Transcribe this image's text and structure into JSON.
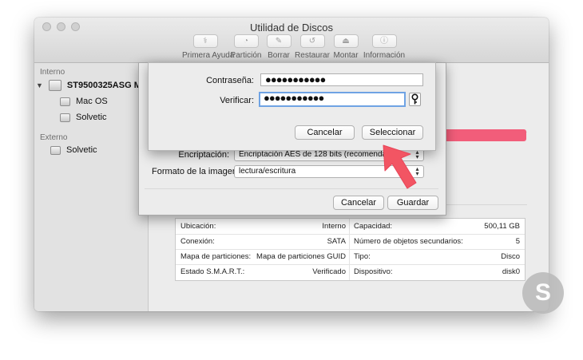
{
  "window": {
    "title": "Utilidad de Discos"
  },
  "toolbar": [
    {
      "label": "Primera Ayuda",
      "icon": "stethoscope-icon"
    },
    {
      "label": "Partición",
      "icon": "partition-icon"
    },
    {
      "label": "Borrar",
      "icon": "erase-icon"
    },
    {
      "label": "Restaurar",
      "icon": "restore-icon"
    },
    {
      "label": "Montar",
      "icon": "mount-icon"
    },
    {
      "label": "Información",
      "icon": "info-icon"
    }
  ],
  "sidebar": {
    "internal_header": "Interno",
    "disk_name": "ST9500325ASG M...",
    "volumes": [
      "Mac OS",
      "Solvetic"
    ],
    "external_header": "Externo",
    "external_volume": "Solvetic"
  },
  "usage_bar": {
    "colors": [
      "#41a7e8",
      "#f25d7a"
    ]
  },
  "info": {
    "left": [
      {
        "label": "Ubicación:",
        "value": "Interno"
      },
      {
        "label": "Conexión:",
        "value": "SATA"
      },
      {
        "label": "Mapa de particiones:",
        "value": "Mapa de particiones GUID"
      },
      {
        "label": "Estado S.M.A.R.T.:",
        "value": "Verificado"
      }
    ],
    "right": [
      {
        "label": "Capacidad:",
        "value": "500,11 GB"
      },
      {
        "label": "Número de objetos secundarios:",
        "value": "5"
      },
      {
        "label": "Tipo:",
        "value": "Disco"
      },
      {
        "label": "Dispositivo:",
        "value": "disk0"
      }
    ]
  },
  "sheet": {
    "encryption_label": "Encriptación:",
    "encryption_value": "Encriptación AES de 128 bits (recomendada)",
    "format_label": "Formato de la imagen:",
    "format_value": "lectura/escritura",
    "cancel": "Cancelar",
    "save": "Guardar"
  },
  "password_dialog": {
    "password_label": "Contraseña:",
    "password_value": "●●●●●●●●●●●",
    "verify_label": "Verificar:",
    "verify_value": "●●●●●●●●●●●",
    "cancel": "Cancelar",
    "select": "Seleccionar"
  },
  "watermark": {
    "letter": "S"
  },
  "accent_color": "#6fa3e4",
  "arrow_color": "#f25563"
}
